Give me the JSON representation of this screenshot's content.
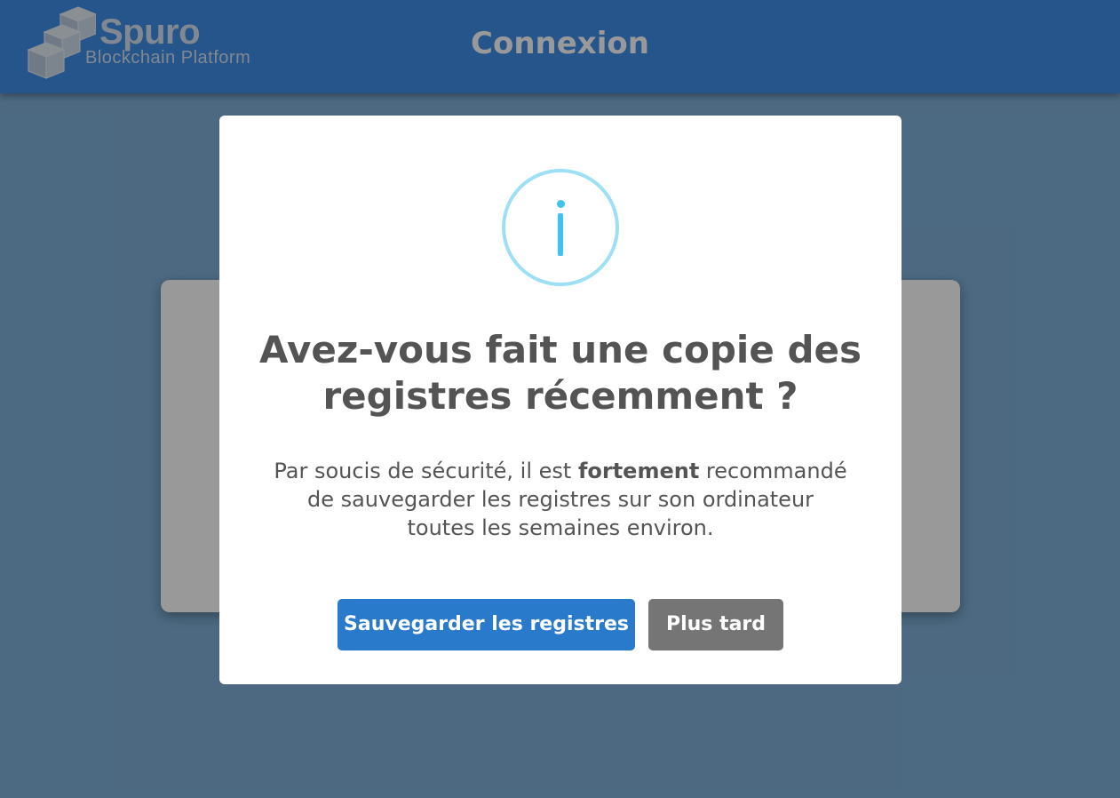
{
  "header": {
    "logo_name": "Spuro",
    "logo_tagline": "Blockchain Platform",
    "title": "Connexion"
  },
  "modal": {
    "icon": "info-icon",
    "title": "Avez-vous fait une copie des registres récemment ?",
    "text_before": "Par soucis de sécurité, il est ",
    "text_emphasis": "fortement",
    "text_after": " recommandé de sauvegarder les registres sur son ordinateur toutes les semaines environ.",
    "confirm_label": "Sauvegarder les registres",
    "cancel_label": "Plus tard"
  },
  "colors": {
    "header": "#3f8ee6",
    "confirm_button": "#2a7acb",
    "cancel_button": "#757575",
    "info_icon": "#3fc3ee",
    "text": "#545454"
  }
}
